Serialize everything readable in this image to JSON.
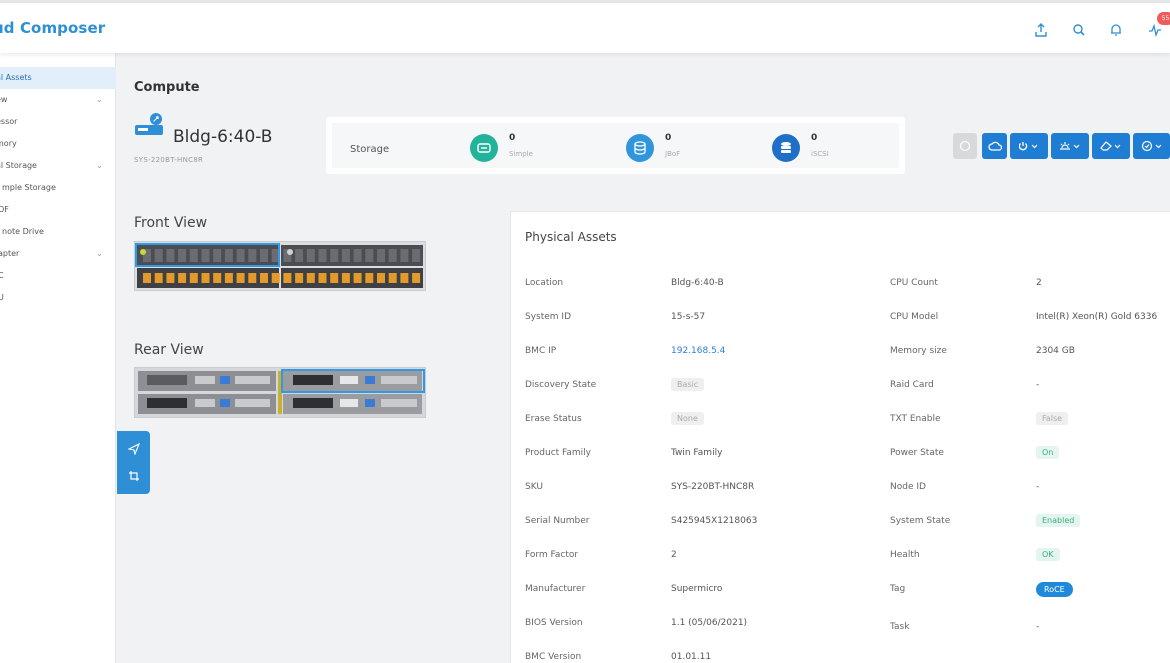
{
  "app": {
    "title": "ud Composer"
  },
  "header": {
    "notification_count": "55"
  },
  "sidebar": {
    "items": [
      {
        "label": "al Assets",
        "active": true,
        "chevron": false
      },
      {
        "label": "ew",
        "chevron": true
      },
      {
        "label": "essor",
        "chevron": false
      },
      {
        "label": "mory",
        "chevron": false
      },
      {
        "label": "al Storage",
        "chevron": true
      },
      {
        "label": "mple Storage",
        "chevron": false
      },
      {
        "label": "OF",
        "chevron": false
      },
      {
        "label": "note Drive",
        "chevron": false
      },
      {
        "label": "apter",
        "chevron": true
      },
      {
        "label": "C",
        "chevron": false
      },
      {
        "label": "U",
        "chevron": false
      }
    ]
  },
  "page": {
    "title": "Compute"
  },
  "server": {
    "name": "Bldg-6:40-B",
    "sku": "SYS-220BT-HNC8R"
  },
  "storage": {
    "label": "Storage",
    "items": [
      {
        "count": "0",
        "name": "Simple",
        "icon": "drive-icon",
        "color": "#23b39b"
      },
      {
        "count": "0",
        "name": "JBoF",
        "icon": "database-icon",
        "color": "#2f96dc"
      },
      {
        "count": "0",
        "name": "iSCSI",
        "icon": "stack-icon",
        "color": "#1f6fc9"
      }
    ]
  },
  "actions": [
    {
      "name": "disabled-action-button",
      "icon": "circle-icon"
    },
    {
      "name": "cloud-button",
      "icon": "cloud-icon"
    },
    {
      "name": "power-button",
      "icon": "power-icon"
    },
    {
      "name": "indicator-button",
      "icon": "light-icon"
    },
    {
      "name": "erase-button",
      "icon": "eraser-icon"
    },
    {
      "name": "health-button",
      "icon": "check-circle-icon"
    }
  ],
  "views": {
    "front": "Front View",
    "rear": "Rear View"
  },
  "assets": {
    "title": "Physical Assets",
    "left": [
      {
        "label": "Location",
        "value": "Bldg-6:40-B",
        "style": "text"
      },
      {
        "label": "System ID",
        "value": "15-s-57",
        "style": "text"
      },
      {
        "label": "BMC IP",
        "value": "192.168.5.4",
        "style": "link"
      },
      {
        "label": "Discovery State",
        "value": "Basic",
        "style": "grey"
      },
      {
        "label": "Erase Status",
        "value": "None",
        "style": "grey"
      },
      {
        "label": "Product Family",
        "value": "Twin Family",
        "style": "text"
      },
      {
        "label": "SKU",
        "value": "SYS-220BT-HNC8R",
        "style": "text"
      },
      {
        "label": "Serial Number",
        "value": "S425945X1218063",
        "style": "text"
      },
      {
        "label": "Form Factor",
        "value": "2",
        "style": "text"
      },
      {
        "label": "Manufacturer",
        "value": "Supermicro",
        "style": "text"
      },
      {
        "label": "BIOS Version",
        "value": "1.1 (05/06/2021)",
        "style": "text"
      },
      {
        "label": "BMC Version",
        "value": "01.01.11",
        "style": "text"
      }
    ],
    "right": [
      {
        "label": "CPU Count",
        "value": "2",
        "style": "text"
      },
      {
        "label": "CPU Model",
        "value": "Intel(R) Xeon(R) Gold 6336",
        "style": "text"
      },
      {
        "label": "Memory size",
        "value": "2304 GB",
        "style": "text"
      },
      {
        "label": "Raid Card",
        "value": "-",
        "style": "text"
      },
      {
        "label": "TXT Enable",
        "value": "False",
        "style": "grey"
      },
      {
        "label": "Power State",
        "value": "On",
        "style": "green"
      },
      {
        "label": "Node ID",
        "value": "-",
        "style": "text"
      },
      {
        "label": "System State",
        "value": "Enabled",
        "style": "green"
      },
      {
        "label": "Health",
        "value": "OK",
        "style": "green"
      },
      {
        "label": "Tag",
        "value": "RoCE",
        "style": "blue"
      },
      {
        "label": "Task",
        "value": "-",
        "style": "text"
      }
    ]
  }
}
